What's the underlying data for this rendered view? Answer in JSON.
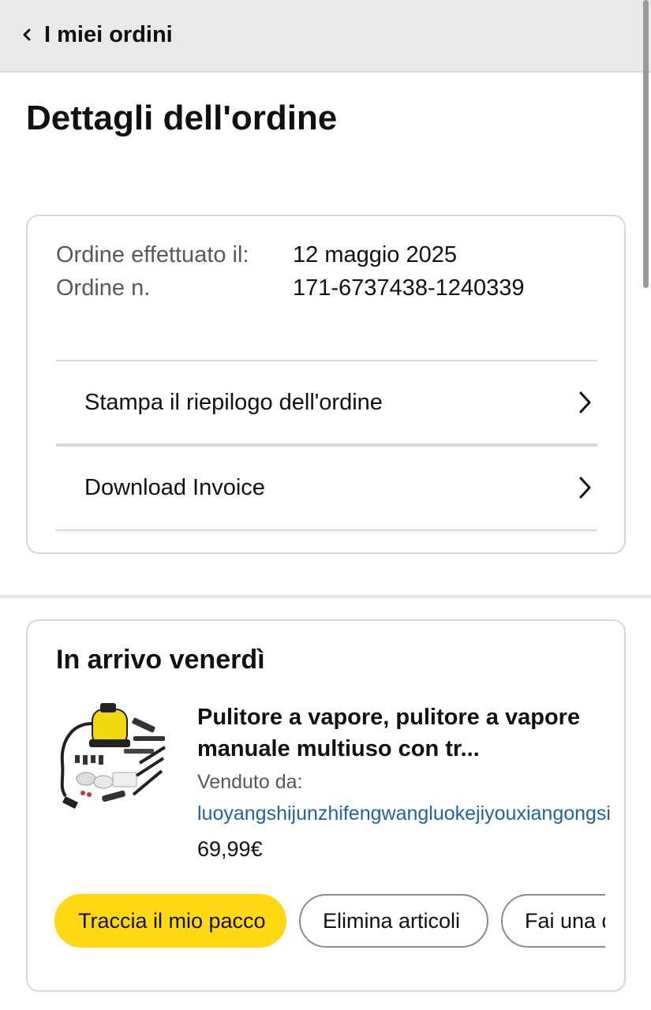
{
  "header": {
    "back_label": "I miei ordini"
  },
  "page": {
    "title": "Dettagli dell'ordine"
  },
  "order_summary": {
    "labels": "Ordine effettuato il:\nOrdine n.",
    "values": "12 maggio 2025\n171-6737438-1240339",
    "actions": [
      {
        "label": "Stampa il riepilogo dell'ordine"
      },
      {
        "label": "Download Invoice"
      }
    ]
  },
  "shipment": {
    "title": "In arrivo venerdì",
    "product": {
      "name": "Pulitore a vapore, pulitore a vapore manuale multiuso con tr...",
      "sold_by_label": "Venduto da:",
      "seller": "luoyangshijunzhifengwangluokejiyouxiangongsi",
      "price": "69,99€"
    },
    "buttons": {
      "track": "Traccia il mio pacco",
      "remove": "Elimina articoli",
      "question": "Fai una domanda"
    }
  },
  "colors": {
    "primary_button": "#ffd814",
    "link": "#2162a1",
    "header_bg": "#eaeaea"
  }
}
